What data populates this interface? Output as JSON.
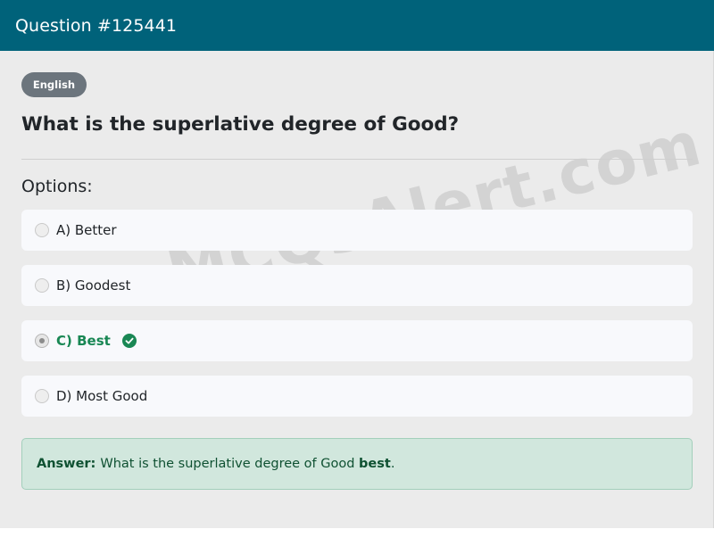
{
  "header": {
    "title": "Question #125441"
  },
  "badge": {
    "label": "English"
  },
  "question": {
    "text": "What is the superlative degree of Good?"
  },
  "options_label": "Options:",
  "options": [
    {
      "text": "A) Better",
      "selected": false,
      "correct": false
    },
    {
      "text": "B) Goodest",
      "selected": false,
      "correct": false
    },
    {
      "text": "C) Best",
      "selected": true,
      "correct": true
    },
    {
      "text": "D) Most Good",
      "selected": false,
      "correct": false
    }
  ],
  "watermark": "MCQsAlert.com",
  "answer": {
    "label": "Answer:",
    "text": "What is the superlative degree of Good",
    "key": "best",
    "suffix": "."
  },
  "colors": {
    "header_bg": "#00627a",
    "correct": "#198754",
    "answer_bg": "#d1e7dd",
    "badge_bg": "#6c757d"
  }
}
